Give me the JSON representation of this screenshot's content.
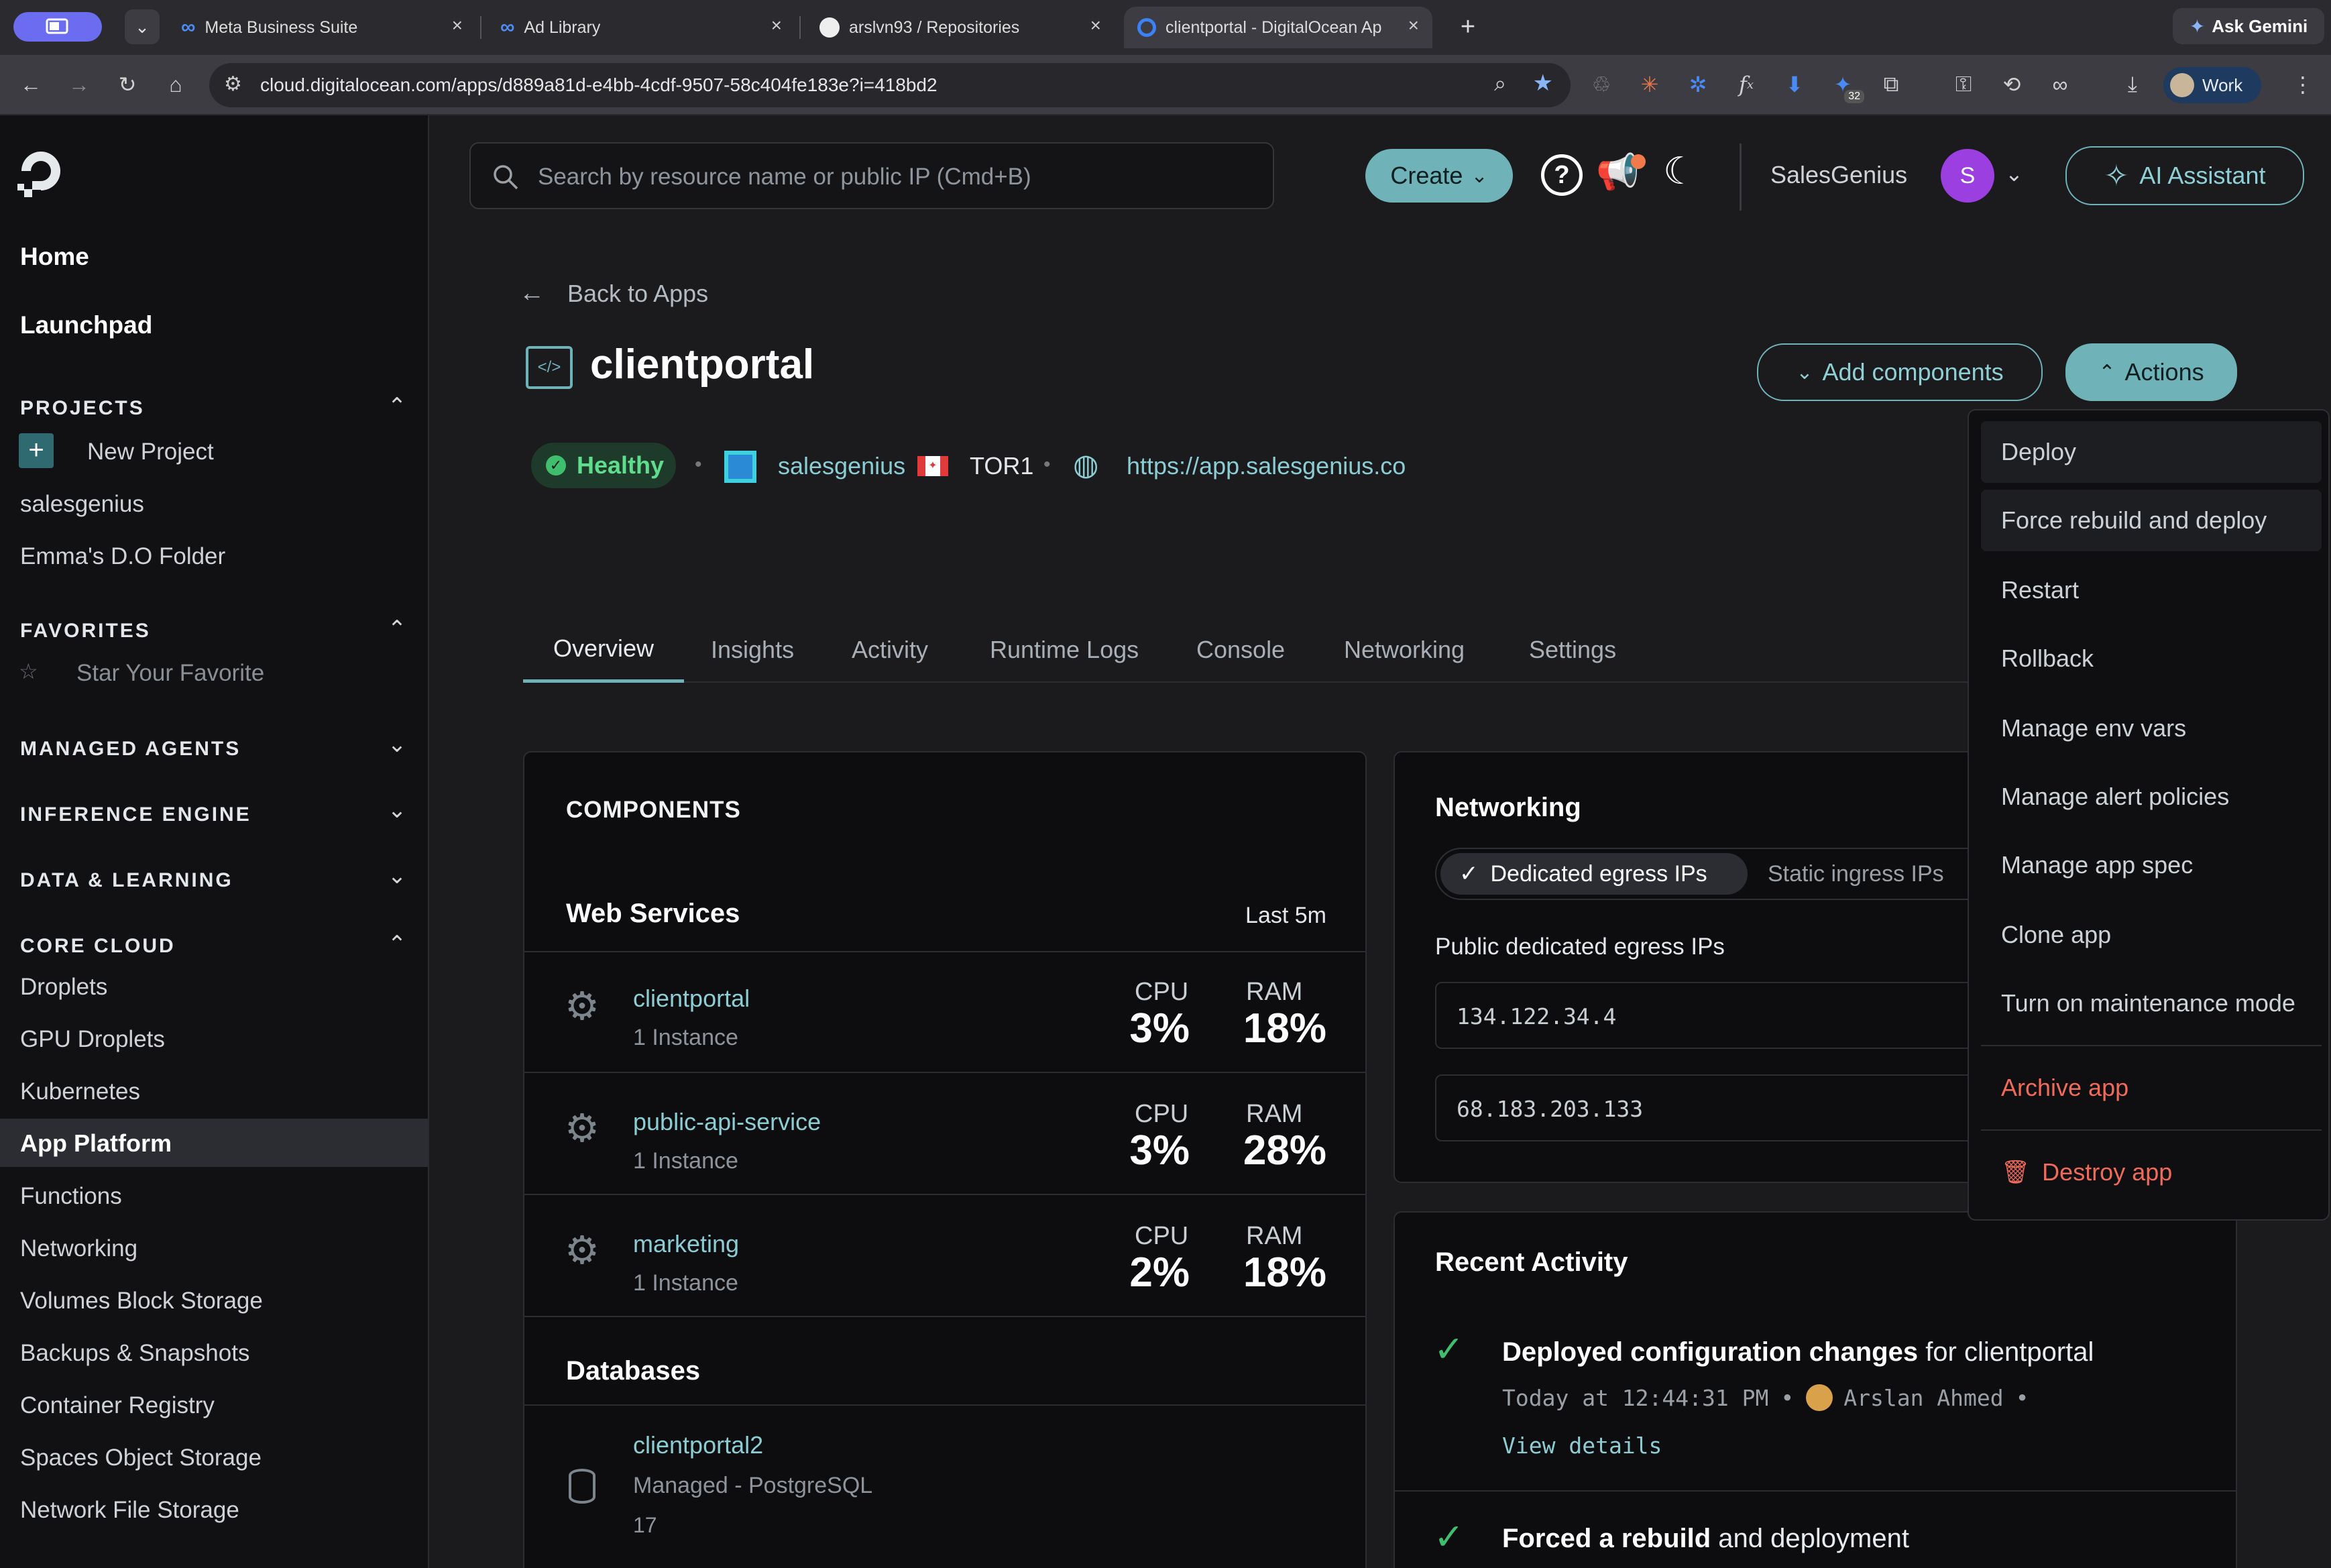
{
  "browser": {
    "tabs": [
      {
        "title": "Meta Business Suite"
      },
      {
        "title": "Ad Library"
      },
      {
        "title": "arslvn93 / Repositories"
      },
      {
        "title": "clientportal - DigitalOcean Ap",
        "active": true
      }
    ],
    "ask_gemini": "Ask Gemini",
    "url": "cloud.digitalocean.com/apps/d889a81d-e4bb-4cdf-9507-58c404fe183e?i=418bd2",
    "extension_badge": "32",
    "profile_label": "Work"
  },
  "sidebar": {
    "home": "Home",
    "launchpad": "Launchpad",
    "projects_header": "PROJECTS",
    "new_project": "New Project",
    "projects": [
      "salesgenius",
      "Emma's D.O Folder"
    ],
    "favorites_header": "FAVORITES",
    "star_favorite": "Star Your Favorite",
    "managed_agents": "MANAGED AGENTS",
    "inference_engine": "INFERENCE ENGINE",
    "data_learning": "DATA & LEARNING",
    "core_cloud": "CORE CLOUD",
    "core_items": [
      "Droplets",
      "GPU Droplets",
      "Kubernetes",
      "App Platform",
      "Functions",
      "Networking",
      "Volumes Block Storage",
      "Backups & Snapshots",
      "Container Registry",
      "Spaces Object Storage",
      "Network File Storage"
    ],
    "active_item": "App Platform"
  },
  "header": {
    "search_placeholder": "Search by resource name or public IP (Cmd+B)",
    "create": "Create",
    "team": "SalesGenius",
    "avatar_initial": "S",
    "ai_assistant": "AI Assistant"
  },
  "app": {
    "back": "Back to Apps",
    "name": "clientportal",
    "status": "Healthy",
    "project": "salesgenius",
    "region": "TOR1",
    "url": "https://app.salesgenius.co",
    "add_components": "Add components",
    "actions": "Actions"
  },
  "tabs": [
    "Overview",
    "Insights",
    "Activity",
    "Runtime Logs",
    "Console",
    "Networking",
    "Settings"
  ],
  "components": {
    "title": "COMPONENTS",
    "web_services": "Web Services",
    "range": "Last 5m",
    "cpu_label": "CPU",
    "ram_label": "RAM",
    "services": [
      {
        "name": "clientportal",
        "instances": "1 Instance",
        "cpu": "3%",
        "ram": "18%"
      },
      {
        "name": "public-api-service",
        "instances": "1 Instance",
        "cpu": "3%",
        "ram": "28%"
      },
      {
        "name": "marketing",
        "instances": "1 Instance",
        "cpu": "2%",
        "ram": "18%"
      }
    ],
    "databases": "Databases",
    "db": {
      "name": "clientportal2",
      "type": "Managed - PostgreSQL",
      "version": "17"
    }
  },
  "networking": {
    "title": "Networking",
    "tab_dedicated": "Dedicated egress IPs",
    "tab_static": "Static ingress IPs",
    "subtitle": "Public dedicated egress IPs",
    "ips": [
      "134.122.34.4",
      "68.183.203.133"
    ]
  },
  "activity": {
    "title": "Recent Activity",
    "item1_strong": "Deployed configuration changes",
    "item1_rest": " for clientportal",
    "item1_meta": "Today at 12:44:31 PM",
    "item1_user": "Arslan Ahmed",
    "item1_link": "View details",
    "item2_strong": "Forced a rebuild",
    "item2_rest": " and deployment"
  },
  "actions_menu": {
    "items": [
      "Deploy",
      "Force rebuild and deploy",
      "Restart",
      "Rollback",
      "Manage env vars",
      "Manage alert policies",
      "Manage app spec",
      "Clone app",
      "Turn on maintenance mode"
    ],
    "archive": "Archive app",
    "destroy": "Destroy app"
  },
  "colors": {
    "accent": "#6fb3b9",
    "healthy": "#3fbf6e",
    "danger": "#f06a5a",
    "avatar": "#9b3fe0"
  }
}
